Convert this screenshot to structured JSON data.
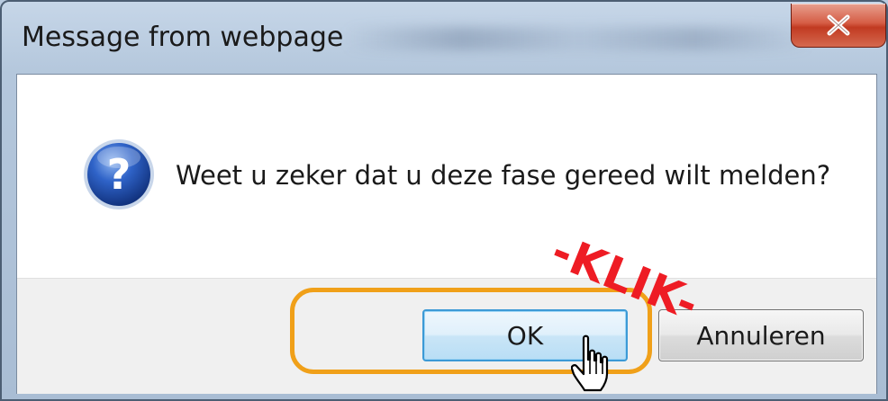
{
  "dialog": {
    "title": "Message from webpage",
    "close_label": "x",
    "message": "Weet u zeker dat u deze fase gereed wilt melden?",
    "icon": "question-icon",
    "buttons": {
      "ok_label": "OK",
      "cancel_label": "Annuleren"
    }
  },
  "annotation": {
    "text": "-KLIK-",
    "color": "#ee1c24",
    "highlight_color": "#f0a019"
  },
  "cursor": "hand-pointer-icon"
}
